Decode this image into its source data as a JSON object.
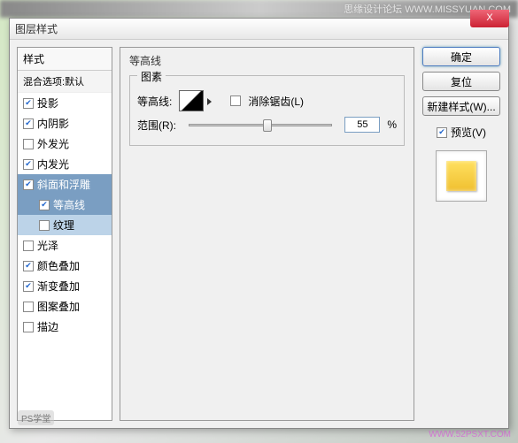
{
  "dialog": {
    "title": "图层样式",
    "close": "X"
  },
  "sidebar": {
    "header": "样式",
    "subheader": "混合选项:默认",
    "items": [
      {
        "label": "投影",
        "checked": true,
        "indent": false,
        "sel": ""
      },
      {
        "label": "内阴影",
        "checked": true,
        "indent": false,
        "sel": ""
      },
      {
        "label": "外发光",
        "checked": false,
        "indent": false,
        "sel": ""
      },
      {
        "label": "内发光",
        "checked": true,
        "indent": false,
        "sel": ""
      },
      {
        "label": "斜面和浮雕",
        "checked": true,
        "indent": false,
        "sel": "dark"
      },
      {
        "label": "等高线",
        "checked": true,
        "indent": true,
        "sel": "dark"
      },
      {
        "label": "纹理",
        "checked": false,
        "indent": true,
        "sel": "light"
      },
      {
        "label": "光泽",
        "checked": false,
        "indent": false,
        "sel": ""
      },
      {
        "label": "颜色叠加",
        "checked": true,
        "indent": false,
        "sel": ""
      },
      {
        "label": "渐变叠加",
        "checked": true,
        "indent": false,
        "sel": ""
      },
      {
        "label": "图案叠加",
        "checked": false,
        "indent": false,
        "sel": ""
      },
      {
        "label": "描边",
        "checked": false,
        "indent": false,
        "sel": ""
      }
    ]
  },
  "main": {
    "section": "等高线",
    "group": "图素",
    "contour_label": "等高线:",
    "antialias_label": "消除锯齿(L)",
    "antialias_checked": false,
    "range_label": "范围(R):",
    "range_value": "55",
    "range_unit": "%"
  },
  "buttons": {
    "ok": "确定",
    "reset": "复位",
    "new_style": "新建样式(W)...",
    "preview_label": "预览(V)",
    "preview_checked": true
  },
  "watermarks": {
    "top": "思缘设计论坛 WWW.MISSYUAN.COM",
    "bl": "PS学堂",
    "br": "WWW.52PSXT.COM"
  }
}
